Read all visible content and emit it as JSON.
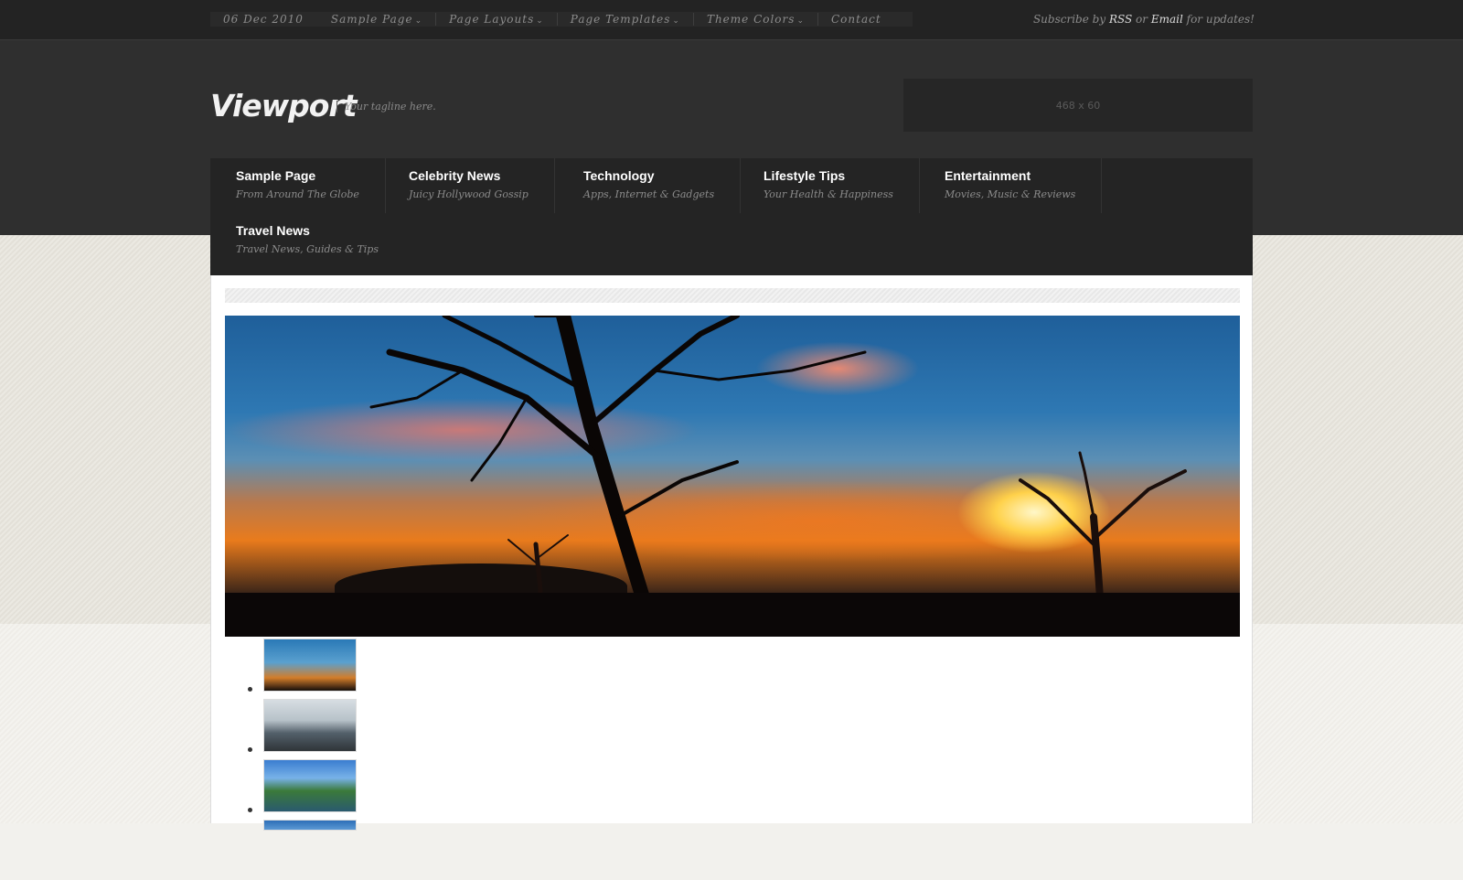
{
  "topbar": {
    "date": "06 Dec 2010",
    "menu": [
      {
        "label": "Sample Page",
        "has_dropdown": true
      },
      {
        "label": "Page Layouts",
        "has_dropdown": true
      },
      {
        "label": "Page Templates",
        "has_dropdown": true
      },
      {
        "label": "Theme Colors",
        "has_dropdown": true
      },
      {
        "label": "Contact",
        "has_dropdown": false
      }
    ],
    "subscribe_prefix": "Subscribe by",
    "subscribe_rss": "RSS",
    "subscribe_or": "or",
    "subscribe_email": "Email",
    "subscribe_suffix": "for updates!"
  },
  "header": {
    "logo": "Viewport",
    "tagline": "Your tagline here.",
    "ad_label": "468 x 60"
  },
  "mainnav": [
    {
      "title": "Sample Page",
      "subtitle": "From Around The Globe"
    },
    {
      "title": "Celebrity News",
      "subtitle": "Juicy Hollywood Gossip"
    },
    {
      "title": "Technology",
      "subtitle": "Apps, Internet & Gadgets"
    },
    {
      "title": "Lifestyle Tips",
      "subtitle": "Your Health & Happiness"
    },
    {
      "title": "Entertainment",
      "subtitle": "Movies, Music & Reviews"
    },
    {
      "title": "Travel News",
      "subtitle": "Travel News, Guides & Tips"
    }
  ],
  "colors": {
    "topbar_bg": "#232323",
    "header_bg": "#2f2f2f",
    "nav_bg": "#242424",
    "page_bg": "#f2f1ed"
  }
}
